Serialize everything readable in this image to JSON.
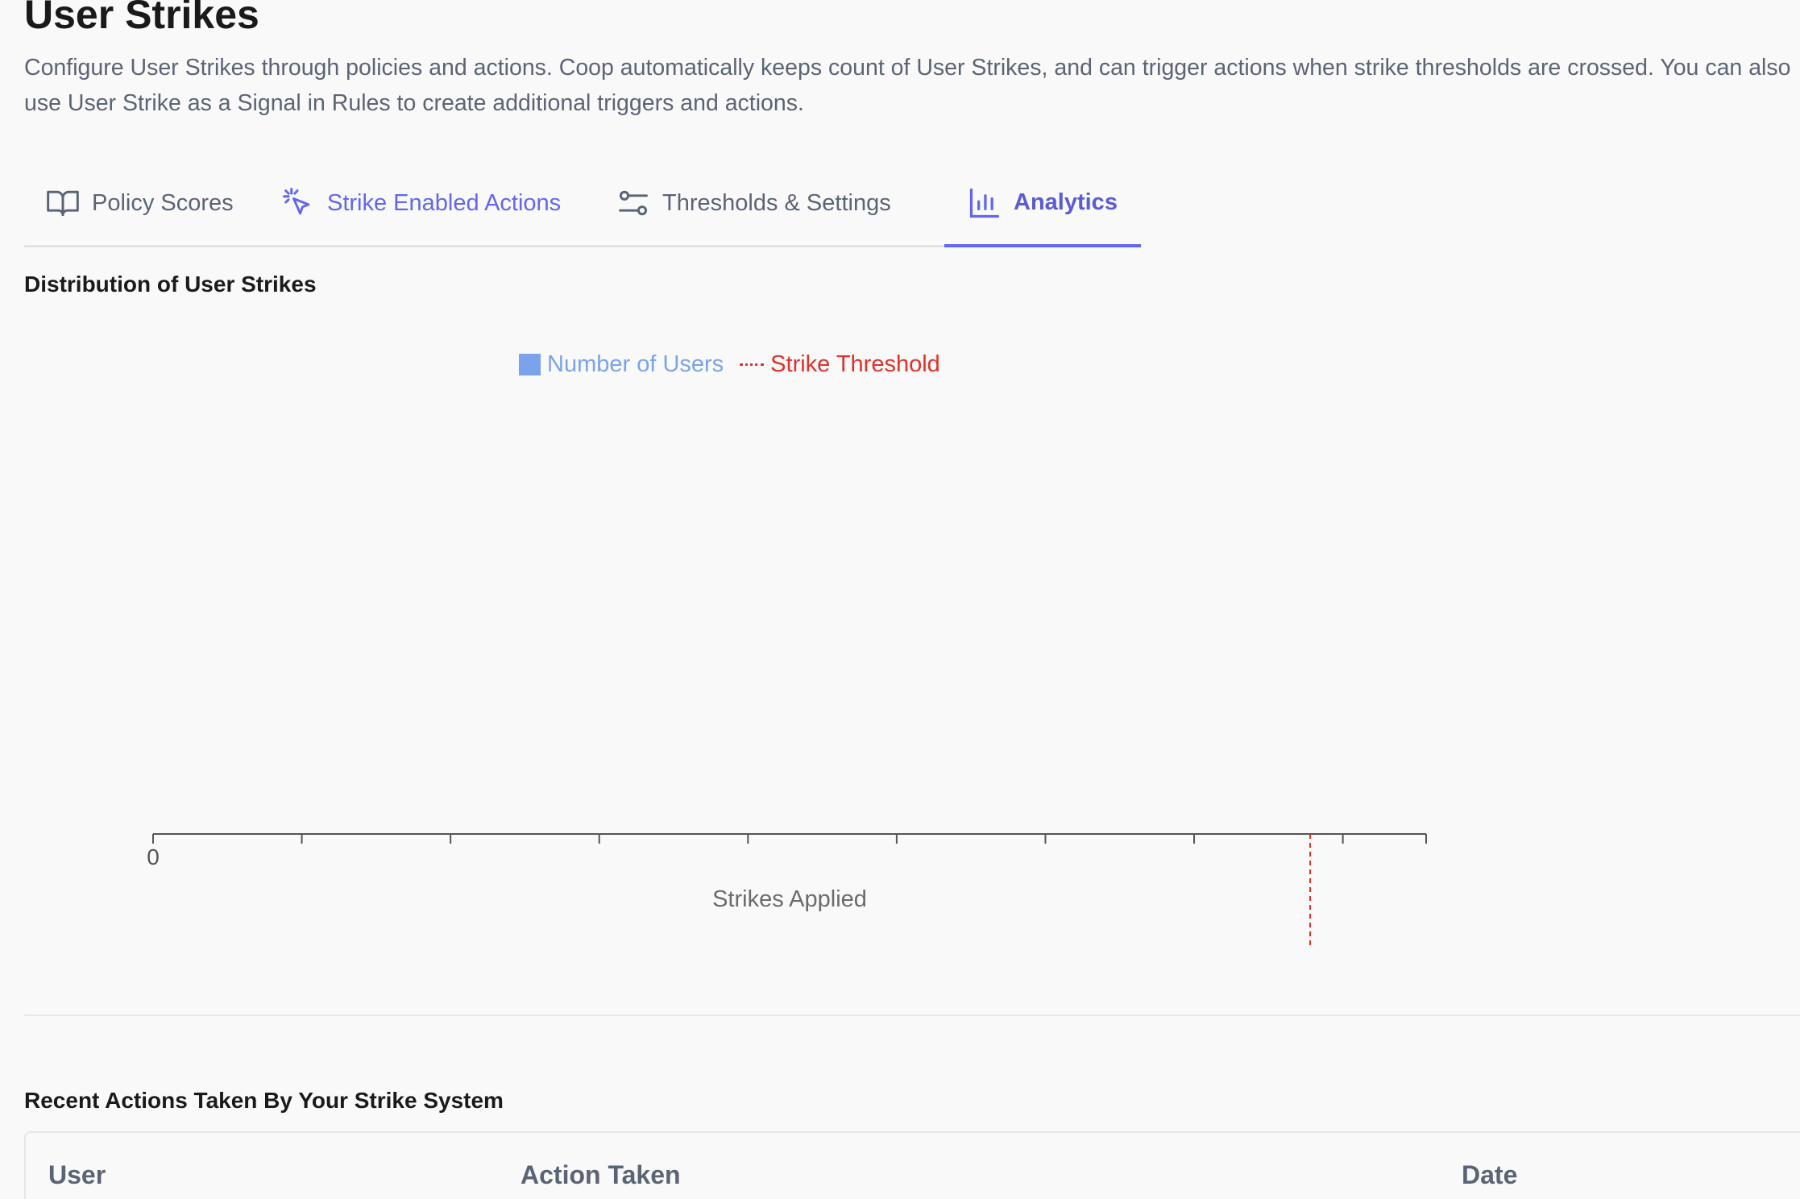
{
  "header": {
    "title": "User Strikes",
    "description": "Configure User Strikes through policies and actions. Coop automatically keeps count of User Strikes, and can trigger actions when strike thresholds are crossed. You can also use User Strike as a Signal in Rules to create additional triggers and actions."
  },
  "tabs": [
    {
      "label": "Policy Scores",
      "icon": "book-open-icon"
    },
    {
      "label": "Strike Enabled Actions",
      "icon": "cursor-click-icon"
    },
    {
      "label": "Thresholds & Settings",
      "icon": "sliders-icon"
    },
    {
      "label": "Analytics",
      "icon": "bar-chart-icon",
      "active": true
    }
  ],
  "colors": {
    "accent": "#6366f1",
    "bar": "#7aa3ec",
    "threshold": "#e0312b",
    "axis": "#555555",
    "muted_text": "#5b6475"
  },
  "chart_section": {
    "title": "Distribution of User Strikes"
  },
  "chart_data": {
    "type": "bar",
    "legend": [
      {
        "label": "Number of Users",
        "kind": "bar",
        "color": "#7aa3ec"
      },
      {
        "label": "Strike Threshold",
        "kind": "dashed-line",
        "color": "#e0312b"
      }
    ],
    "legend_position": "top-center",
    "xlabel": "Strikes Applied",
    "ylabel": "",
    "x_tick_labels": [
      "0",
      "",
      "",
      "",
      "",
      "",
      "",
      "",
      ""
    ],
    "xlim": [
      0,
      8.56
    ],
    "series": [
      {
        "name": "Number of Users",
        "values": []
      }
    ],
    "strike_threshold": 7.78,
    "grid": false
  },
  "recent_section": {
    "title": "Recent Actions Taken By Your Strike System"
  },
  "table": {
    "columns": [
      "User",
      "Action Taken",
      "Date"
    ],
    "rows": []
  }
}
